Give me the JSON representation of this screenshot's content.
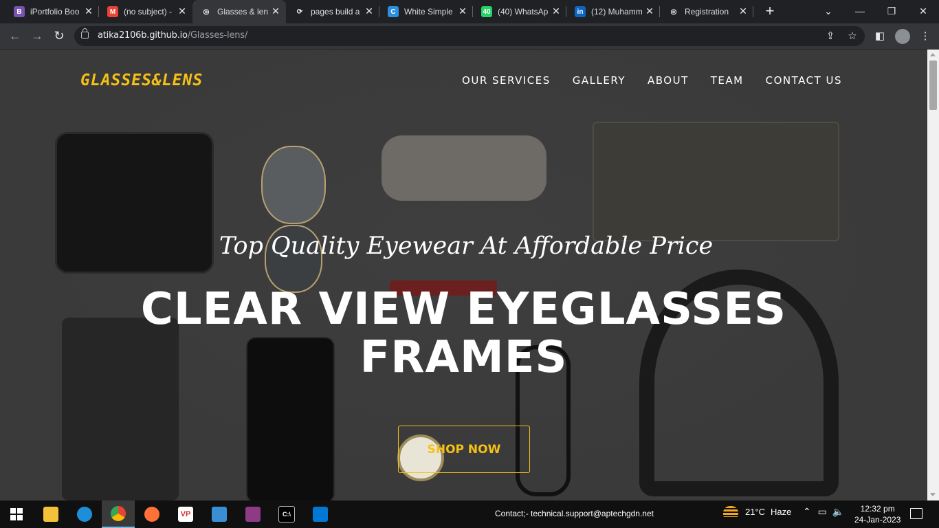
{
  "browser": {
    "tabs": [
      {
        "title": "iPortfolio Boo",
        "icon": "bootstrap-icon",
        "icon_glyph": "B",
        "icon_color": "#7952b3"
      },
      {
        "title": "(no subject) -",
        "icon": "gmail-icon",
        "icon_glyph": "M",
        "icon_color": "#ea4335"
      },
      {
        "title": "Glasses & len",
        "icon": "globe-icon",
        "icon_glyph": "◎",
        "icon_color": "#35363a"
      },
      {
        "title": "pages build a",
        "icon": "github-actions-icon",
        "icon_glyph": "⟳",
        "icon_color": "#202124"
      },
      {
        "title": "White Simple",
        "icon": "canva-icon",
        "icon_glyph": "C",
        "icon_color": "#2d8fe0"
      },
      {
        "title": "(40) WhatsAp",
        "icon": "whatsapp-icon",
        "icon_glyph": "40",
        "icon_color": "#25d366"
      },
      {
        "title": "(12) Muhamm",
        "icon": "linkedin-icon",
        "icon_glyph": "in",
        "icon_color": "#0a66c2"
      },
      {
        "title": "Registration",
        "icon": "globe-icon",
        "icon_glyph": "◎",
        "icon_color": "#202124"
      }
    ],
    "active_tab": 2,
    "new_tab_label": "+",
    "url_host": "atika2106b.github.io",
    "url_path": "/Glasses-lens/"
  },
  "site": {
    "logo": "GLASSES&LENS",
    "nav": [
      "OUR SERVICES",
      "GALLERY",
      "ABOUT",
      "TEAM",
      "CONTACT US"
    ],
    "subtitle": "Top Quality Eyewear At Affordable Price",
    "headline_line1": "CLEAR VIEW EYEGLASSES",
    "headline_line2": "FRAMES",
    "cta": "SHOP NOW",
    "accent_color": "#f5c116"
  },
  "taskbar": {
    "contact": "Contact;-   technical.support@aptechgdn.net",
    "temperature": "21°C",
    "weather": "Haze",
    "time": "12:32 pm",
    "date": "24-Jan-2023"
  }
}
